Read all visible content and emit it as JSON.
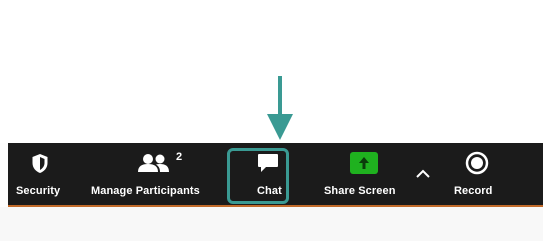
{
  "toolbar": {
    "items": [
      {
        "label": "Security",
        "icon": "shield-icon"
      },
      {
        "label": "Manage Participants",
        "icon": "participants-icon",
        "count": "2"
      },
      {
        "label": "Chat",
        "icon": "chat-icon"
      },
      {
        "label": "Share Screen",
        "icon": "share-screen-icon"
      },
      {
        "label": "",
        "icon": "chevron-up-icon"
      },
      {
        "label": "Record",
        "icon": "record-icon"
      }
    ]
  },
  "colors": {
    "toolbar_bg": "#1b1b1b",
    "highlight": "#3a9a93",
    "share_green": "#1fb11f",
    "label_text": "#ffffff"
  }
}
